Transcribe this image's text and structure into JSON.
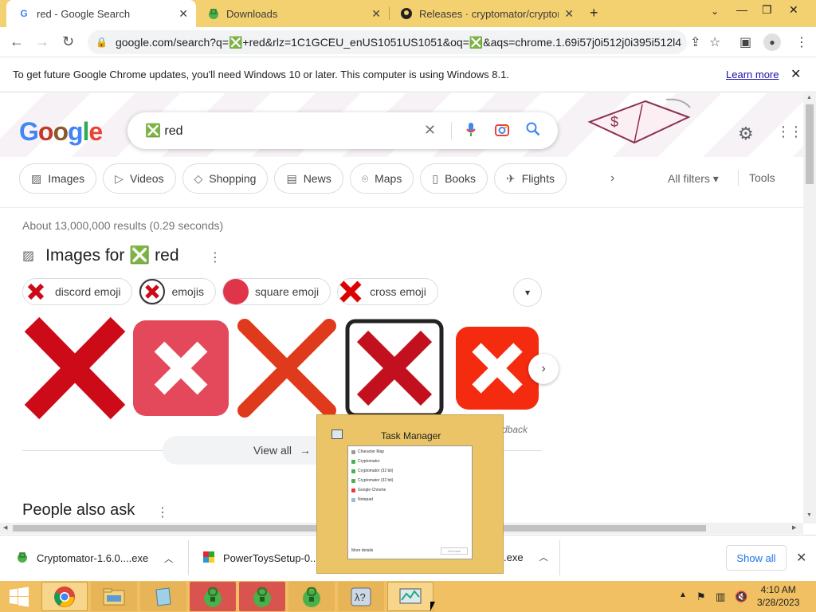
{
  "tabs": [
    {
      "title": "red - Google Search",
      "favicon": "G"
    },
    {
      "title": "Downloads",
      "favicon": "cryptomator-icon"
    },
    {
      "title": "Releases · cryptomator/cryptoma",
      "favicon": "github-icon"
    }
  ],
  "address": {
    "url": "google.com/search?q=❎+red&rlz=1C1GCEU_enUS1051US1051&oq=❎&aqs=chrome.1.69i57j0i512j0i395i512l4..."
  },
  "infobar": {
    "message": "To get future Google Chrome updates, you'll need Windows 10 or later. This computer is using Windows 8.1.",
    "learn_more": "Learn more"
  },
  "search": {
    "query": "❎ red"
  },
  "filters": {
    "chips": [
      "Images",
      "Videos",
      "Shopping",
      "News",
      "Maps",
      "Books",
      "Flights"
    ],
    "all_filters": "All filters",
    "tools": "Tools"
  },
  "results": {
    "stats": "About 13,000,000 results (0.29 seconds)",
    "images_heading": "Images for ❎ red",
    "related": [
      "discord emoji",
      "emojis",
      "square emoji",
      "cross emoji"
    ],
    "feedback": "dback",
    "view_all": "View all",
    "people_also_ask": "People also ask"
  },
  "task_manager": {
    "title": "Task Manager",
    "rows": [
      "Character Map",
      "Cryptomator",
      "Cryptomator (32 bit)",
      "Cryptomator (32 bit)",
      "Google Chrome",
      "Notepad"
    ],
    "more_details": "More details",
    "end_task": "End task"
  },
  "downloads": {
    "items": [
      "Cryptomator-1.6.0....exe",
      "PowerToysSetup-0...",
      ".exe"
    ],
    "show_all": "Show all"
  },
  "clock": {
    "time": "4:10 AM",
    "date": "3/28/2023"
  },
  "colors": {
    "taskbar": "#f0c062",
    "tabbar": "#f3d070",
    "red_x": "#cc0a18"
  }
}
